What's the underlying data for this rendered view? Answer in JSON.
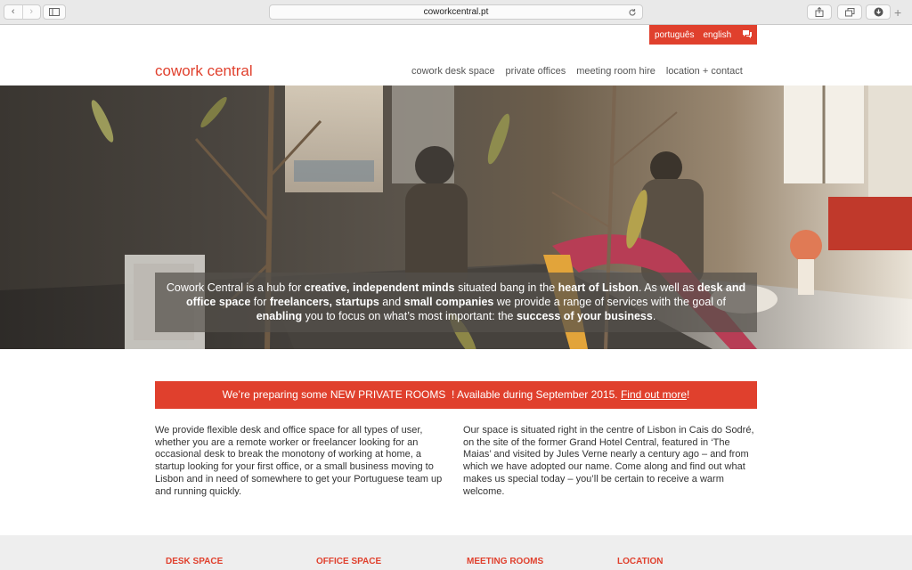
{
  "browser": {
    "url": "coworkcentral.pt",
    "back_icon": "‹",
    "forward_icon": "›",
    "plus_icon": "+"
  },
  "lang": {
    "portuguese": "português",
    "english": "english"
  },
  "logo": "cowork central",
  "nav": {
    "desk": "cowork desk space",
    "private": "private offices",
    "meeting": "meeting room hire",
    "location": "location + contact"
  },
  "hero": {
    "t1": "Cowork Central is a hub for ",
    "b1": "creative, independent minds",
    "t2": " situated bang in the ",
    "b2": "heart of Lisbon",
    "t3": ". As well as ",
    "b3": "desk and office space",
    "t4": " for ",
    "b4": "freelancers, startups",
    "t5": " and ",
    "b5": "small companies",
    "t6": " we provide a range of services with the goal of ",
    "b6": "enabling",
    "t7": " you to focus on what’s most important: the ",
    "b7": "success of your business",
    "t8": "."
  },
  "announce": {
    "pre": "We’re preparing some ",
    "strong": "NEW PRIVATE ROOMS",
    "mid": "  ! Available during September 2015. ",
    "link": "Find out more",
    "end": "!"
  },
  "body": {
    "left": "We provide flexible desk and office space for all types of user, whether you are a remote worker or freelancer looking for an occasional desk to break the monotony of working at home, a startup looking for your first office, or a small business moving to Lisbon and in need of somewhere to get your Portuguese team up and running quickly.",
    "right": "Our space is situated right in the centre of Lisbon in Cais do Sodré, on the site of the former Grand Hotel Central, featured in ‘The Maias’ and visited by Jules Verne nearly a century ago – and from which we have adopted our name. Come along and find out what makes us special today – you’ll be certain to receive a warm welcome."
  },
  "footer": {
    "desk": "DESK SPACE",
    "office": "OFFICE SPACE",
    "meeting": "MEETING ROOMS",
    "location": "LOCATION"
  },
  "colors": {
    "accent": "#e0402d"
  }
}
